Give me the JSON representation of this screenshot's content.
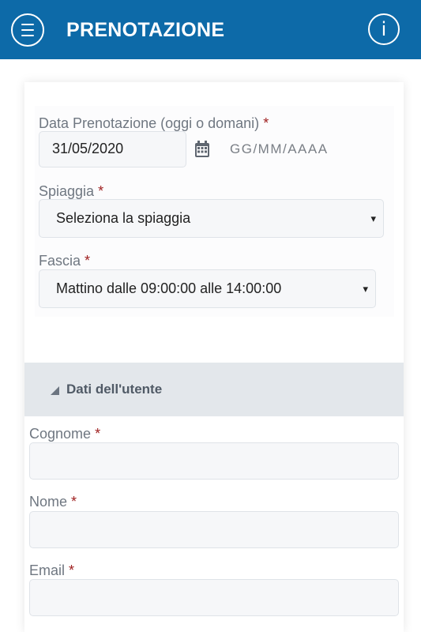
{
  "header": {
    "title": "PRENOTAZIONE",
    "menu_icon": "hamburger-menu-icon",
    "info_label": "i",
    "bg_color": "#0d6aa8"
  },
  "booking": {
    "date_label": "Data Prenotazione (oggi o domani)",
    "date_value": "31/05/2020",
    "date_format_hint": "GG/MM/AAAA",
    "calendar_icon": "calendar-icon",
    "beach_label": "Spiaggia",
    "beach_value": "Seleziona la spiaggia",
    "slot_label": "Fascia",
    "slot_value": "Mattino dalle 09:00:00 alle 14:00:00"
  },
  "user_section": {
    "title": "Dati dell'utente",
    "surname_label": "Cognome",
    "name_label": "Nome",
    "email_label": "Email"
  },
  "required_mark": "*",
  "dropdown_caret": "▾"
}
